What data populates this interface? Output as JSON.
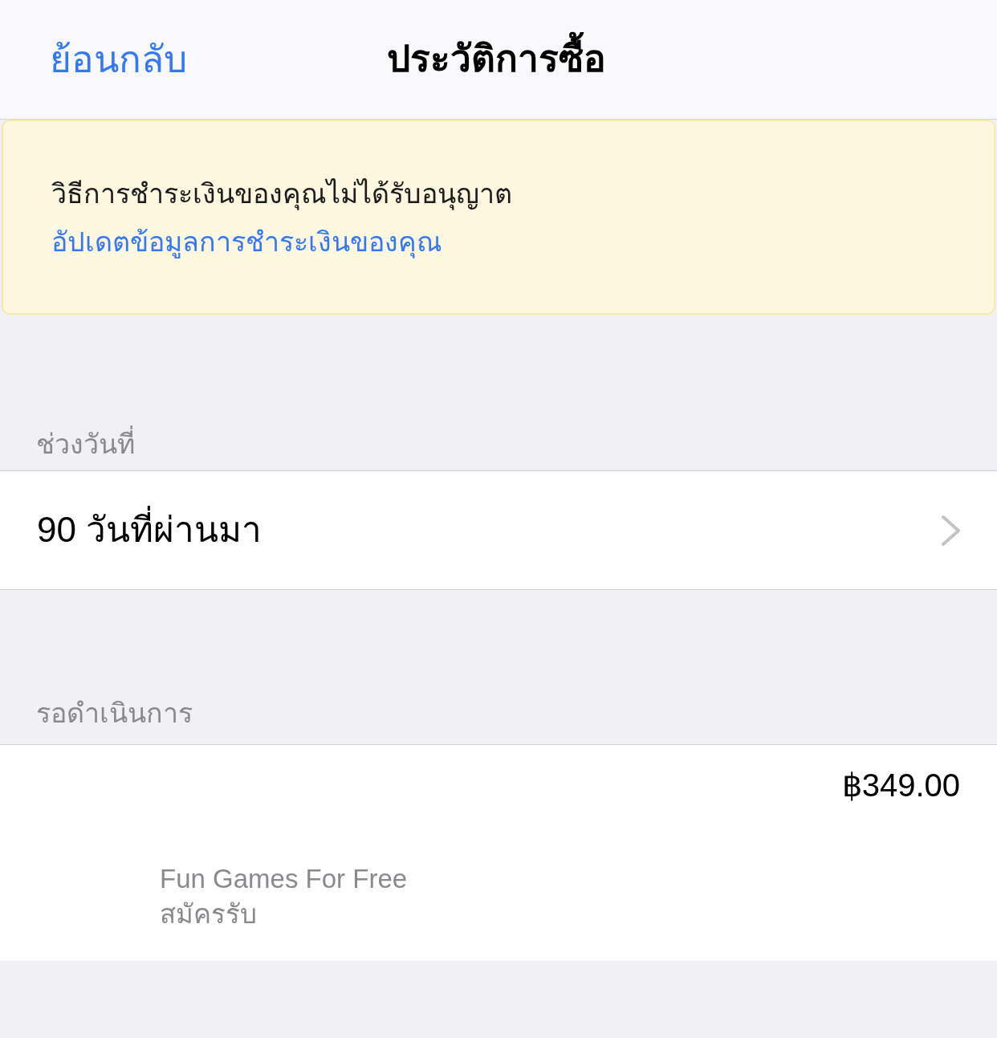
{
  "nav": {
    "back": "ย้อนกลับ",
    "title": "ประวัติการซื้อ"
  },
  "banner": {
    "message": "วิธีการชำระเงินของคุณไม่ได้รับอนุญาต",
    "link": "อัปเดตข้อมูลการชำระเงินของคุณ"
  },
  "date_range": {
    "header": "ช่วงวันที่",
    "value": "90 วันที่ผ่านมา"
  },
  "pending": {
    "header": "รอดำเนินการ",
    "items": [
      {
        "price": "฿349.00",
        "developer": "Fun Games For Free",
        "type": "สมัครรับ"
      }
    ]
  }
}
